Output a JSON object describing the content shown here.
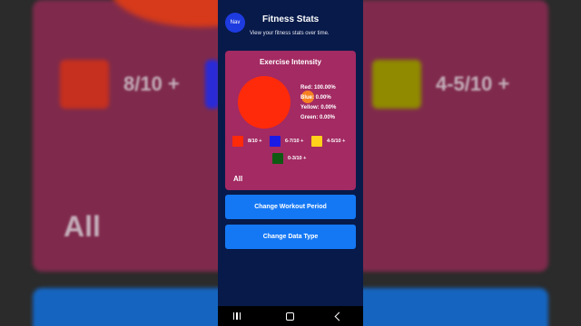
{
  "background": {
    "left_label": "8/10 +",
    "right_label": "4-5/10 +",
    "all_label": "All",
    "colors": {
      "card": "#8e2a52",
      "red": "#c5301f",
      "yellow": "#8f8a00",
      "blue": "#1565c0"
    }
  },
  "header": {
    "nav_label": "Nav",
    "title": "Fitness Stats",
    "subtitle": "View your fitness stats over time."
  },
  "card": {
    "title": "Exercise Intensity",
    "stats": [
      {
        "label": "Red: 100.00%"
      },
      {
        "label": "Blue: 0.00%"
      },
      {
        "label": "Yellow: 0.00%"
      },
      {
        "label": "Green: 0.00%"
      }
    ],
    "legend": [
      {
        "label": "8/10 +",
        "color": "#ff2a0a"
      },
      {
        "label": "6-7/10 +",
        "color": "#1a1ae6"
      },
      {
        "label": "4-5/10 +",
        "color": "#ffd11a"
      },
      {
        "label": "0-3/10 +",
        "color": "#0e5a12"
      }
    ],
    "filter_label": "All",
    "pie": {
      "red": 100,
      "blue": 0,
      "yellow": 0,
      "green": 0
    }
  },
  "buttons": {
    "change_period": "Change Workout Period",
    "change_type": "Change Data Type"
  },
  "navbar": {
    "icons": [
      "recents-icon",
      "home-icon",
      "back-icon"
    ]
  }
}
